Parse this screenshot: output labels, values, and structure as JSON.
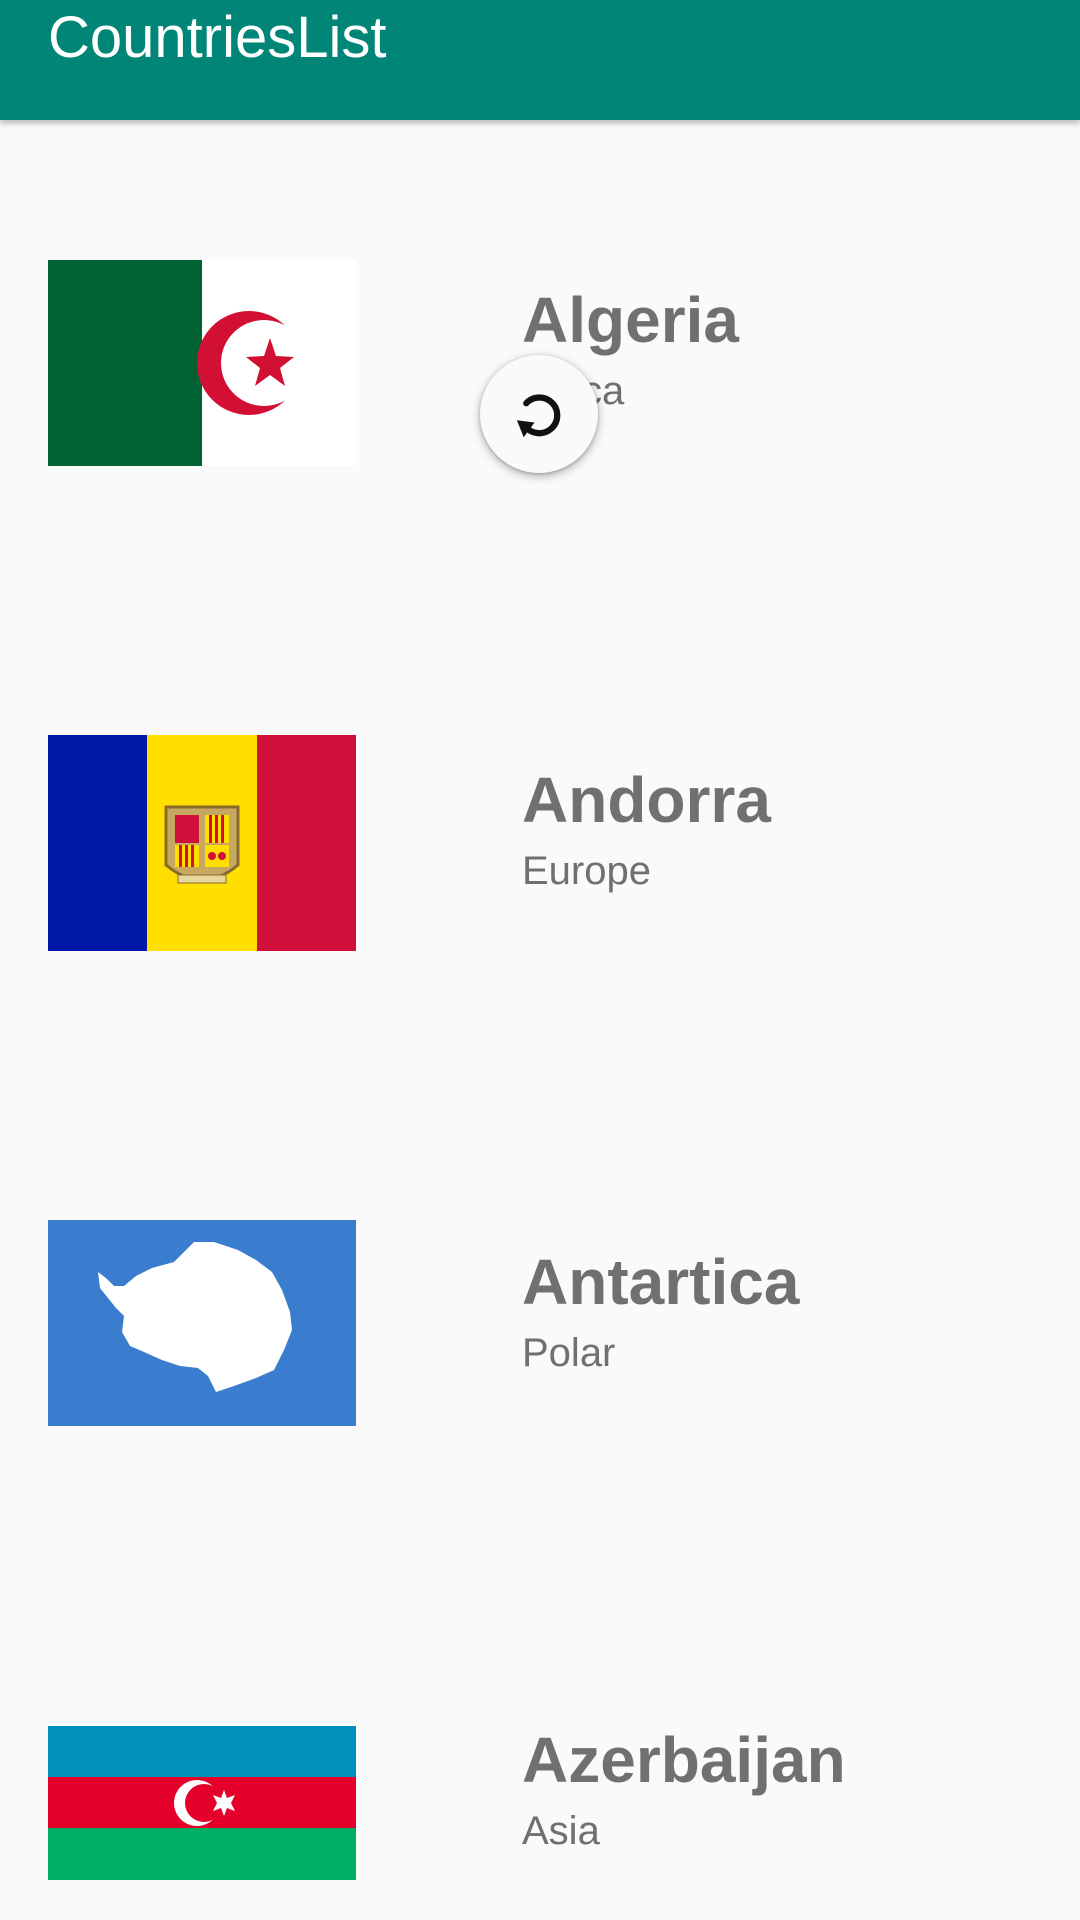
{
  "app": {
    "title": "CountriesList"
  },
  "countries": [
    {
      "name": "Algeria",
      "region": "Africa",
      "flag_icon": "algeria-flag"
    },
    {
      "name": "Andorra",
      "region": "Europe",
      "flag_icon": "andorra-flag"
    },
    {
      "name": "Antartica",
      "region": "Polar",
      "flag_icon": "antarctica-flag"
    },
    {
      "name": "Azerbaijan",
      "region": "Asia",
      "flag_icon": "azerbaijan-flag"
    }
  ],
  "refresh_indicator": {
    "icon": "refresh-icon"
  },
  "colors": {
    "app_bar": "#008577",
    "text": "#707070",
    "background": "#fafafa"
  }
}
